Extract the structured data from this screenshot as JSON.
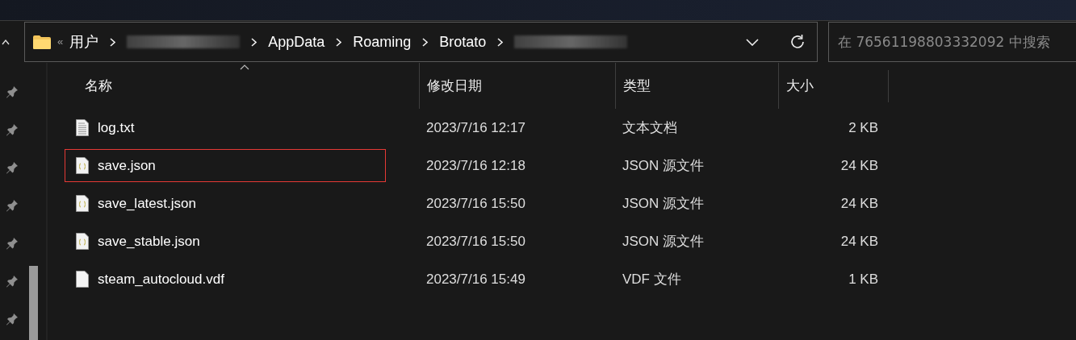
{
  "address_bar": {
    "overflow": "«",
    "segments": [
      {
        "kind": "text",
        "label": "用户"
      },
      {
        "kind": "blurred"
      },
      {
        "kind": "text",
        "label": "AppData"
      },
      {
        "kind": "text",
        "label": "Roaming"
      },
      {
        "kind": "text",
        "label": "Brotato"
      },
      {
        "kind": "blurred"
      }
    ]
  },
  "search": {
    "placeholder": "在 76561198803332092 中搜索"
  },
  "columns": [
    {
      "label": "名称",
      "sorted": true
    },
    {
      "label": "修改日期",
      "sorted": false
    },
    {
      "label": "类型",
      "sorted": false
    },
    {
      "label": "大小",
      "sorted": false
    }
  ],
  "files": [
    {
      "name": "log.txt",
      "kind": "text",
      "modified": "2023/7/16 12:17",
      "type": "文本文档",
      "size": "2 KB",
      "outlined": false
    },
    {
      "name": "save.json",
      "kind": "json",
      "modified": "2023/7/16 12:18",
      "type": "JSON 源文件",
      "size": "24 KB",
      "outlined": true
    },
    {
      "name": "save_latest.json",
      "kind": "json",
      "modified": "2023/7/16 15:50",
      "type": "JSON 源文件",
      "size": "24 KB",
      "outlined": false
    },
    {
      "name": "save_stable.json",
      "kind": "json",
      "modified": "2023/7/16 15:50",
      "type": "JSON 源文件",
      "size": "24 KB",
      "outlined": false
    },
    {
      "name": "steam_autocloud.vdf",
      "kind": "blank",
      "modified": "2023/7/16 15:49",
      "type": "VDF 文件",
      "size": "1 KB",
      "outlined": false
    }
  ]
}
